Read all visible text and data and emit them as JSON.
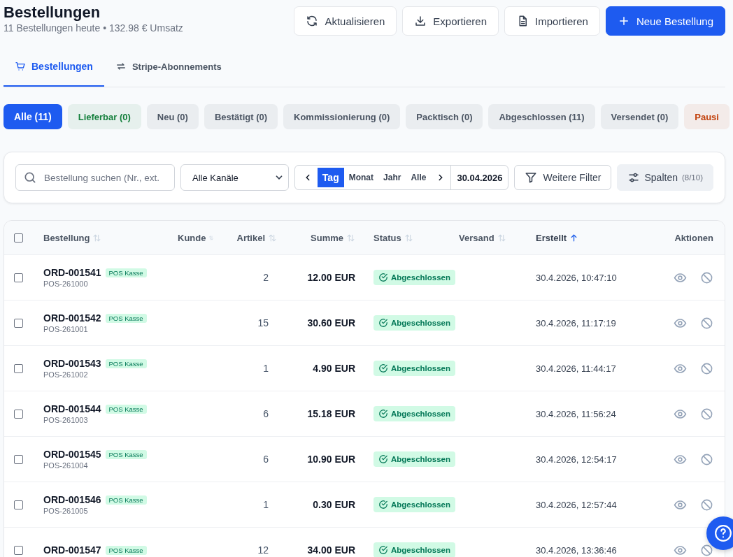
{
  "header": {
    "title": "Bestellungen",
    "subtitle": "11 Bestellungen heute • 132.98 € Umsatz"
  },
  "actions": [
    {
      "kind": "refresh",
      "label": "Aktualisieren"
    },
    {
      "kind": "export",
      "label": "Exportieren"
    },
    {
      "kind": "import",
      "label": "Importieren"
    },
    {
      "kind": "new",
      "label": "Neue Bestellung"
    }
  ],
  "tabs": [
    {
      "kind": "cart",
      "label": "Bestellungen",
      "selected": true
    },
    {
      "kind": "repeat",
      "label": "Stripe-Abonnements",
      "selected": false
    }
  ],
  "status_filters": [
    {
      "label": "Alle (11)",
      "selected": true,
      "color": "#1e5bf0"
    },
    {
      "label": "Lieferbar (0)",
      "selected": false,
      "color": "#15803d"
    },
    {
      "label": "Neu (0)",
      "selected": false,
      "color": "#4b5563"
    },
    {
      "label": "Bestätigt (0)",
      "selected": false,
      "color": "#4b5563"
    },
    {
      "label": "Kommissionierung (0)",
      "selected": false,
      "color": "#4b5563"
    },
    {
      "label": "Packtisch (0)",
      "selected": false,
      "color": "#4b5563"
    },
    {
      "label": "Abgeschlossen (11)",
      "selected": false,
      "color": "#4b5563"
    },
    {
      "label": "Versendet (0)",
      "selected": false,
      "color": "#4b5563"
    },
    {
      "label": "Pausi",
      "selected": false,
      "color": "#c2410c"
    }
  ],
  "toolbar": {
    "search": {
      "placeholder": "Bestellung suchen (Nr., ext."
    },
    "channel": {
      "value": "Alle Kanäle"
    },
    "periods": [
      {
        "label": "Tag",
        "selected": true
      },
      {
        "label": "Monat",
        "selected": false
      },
      {
        "label": "Jahr",
        "selected": false
      },
      {
        "label": "Alle",
        "selected": false
      }
    ],
    "date": "30.04.2026",
    "more_filters": "Weitere Filter",
    "columns": {
      "label": "Spalten",
      "count": "(8/10)"
    }
  },
  "table": {
    "all_checked": false,
    "columns": [
      {
        "label": "Bestellung",
        "sortable": true,
        "sorted": false
      },
      {
        "label": "Kunde",
        "sortable": true,
        "sorted": false
      },
      {
        "label": "Artikel",
        "sortable": true,
        "sorted": false
      },
      {
        "label": "Summe",
        "sortable": true,
        "sorted": false
      },
      {
        "label": "Status",
        "sortable": true,
        "sorted": false
      },
      {
        "label": "Versand",
        "sortable": true,
        "sorted": false
      },
      {
        "label": "Erstellt",
        "sortable": true,
        "sorted": true
      },
      {
        "label": "Aktionen",
        "sortable": false,
        "sorted": false
      }
    ],
    "rows": [
      {
        "checked": false,
        "order": "ORD-001541",
        "channel": "POS Kasse",
        "ref": "POS-261000",
        "items": "2",
        "total": "12.00 EUR",
        "status": "Abgeschlossen",
        "created": "30.4.2026, 10:47:10"
      },
      {
        "checked": false,
        "order": "ORD-001542",
        "channel": "POS Kasse",
        "ref": "POS-261001",
        "items": "15",
        "total": "30.60 EUR",
        "status": "Abgeschlossen",
        "created": "30.4.2026, 11:17:19"
      },
      {
        "checked": false,
        "order": "ORD-001543",
        "channel": "POS Kasse",
        "ref": "POS-261002",
        "items": "1",
        "total": "4.90 EUR",
        "status": "Abgeschlossen",
        "created": "30.4.2026, 11:44:17"
      },
      {
        "checked": false,
        "order": "ORD-001544",
        "channel": "POS Kasse",
        "ref": "POS-261003",
        "items": "6",
        "total": "15.18 EUR",
        "status": "Abgeschlossen",
        "created": "30.4.2026, 11:56:24"
      },
      {
        "checked": false,
        "order": "ORD-001545",
        "channel": "POS Kasse",
        "ref": "POS-261004",
        "items": "6",
        "total": "10.90 EUR",
        "status": "Abgeschlossen",
        "created": "30.4.2026, 12:54:17"
      },
      {
        "checked": false,
        "order": "ORD-001546",
        "channel": "POS Kasse",
        "ref": "POS-261005",
        "items": "1",
        "total": "0.30 EUR",
        "status": "Abgeschlossen",
        "created": "30.4.2026, 12:57:44"
      },
      {
        "checked": false,
        "order": "ORD-001547",
        "channel": "POS Kasse",
        "items": "12",
        "total": "34.00 EUR",
        "status": "Abgeschlossen",
        "created": "30.4.2026, 13:36:46"
      }
    ]
  }
}
